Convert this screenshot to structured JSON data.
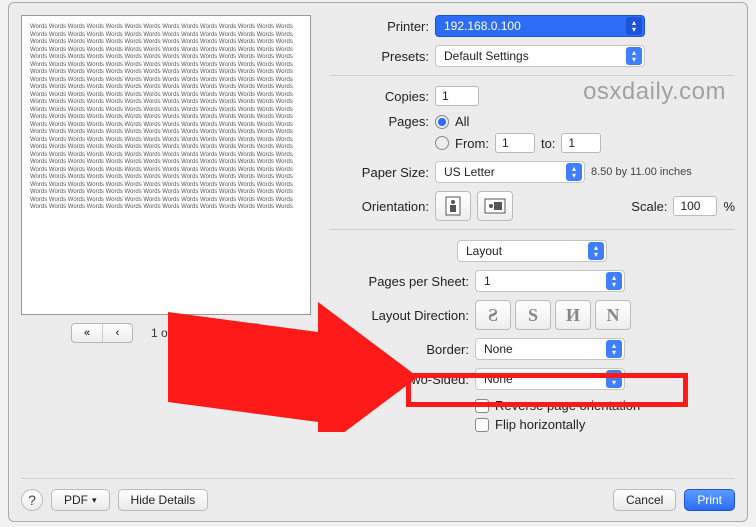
{
  "watermark": "osxdaily.com",
  "preview": {
    "page_indicator": "1 of 3",
    "filler": "Words Words Words Words Words Words Words Words Words Words Words Words Words Words Words Words Words Words Words Words Words Words Words Words Words Words Words Words Words Words Words Words Words Words Words Words Words Words Words Words Words Words Words Words Words Words Words Words Words Words Words Words Words Words Words Words Words Words Words Words Words Words Words Words Words Words Words Words Words Words Words Words Words Words Words Words Words Words Words Words Words Words Words Words Words Words Words Words Words Words Words Words Words Words Words Words Words Words Words Words Words Words Words Words Words Words Words Words Words Words Words Words Words Words Words Words Words Words Words Words Words Words Words Words Words Words Words Words Words Words Words Words Words Words Words Words Words Words Words Words Words Words Words Words Words Words Words Words Words Words Words Words Words Words Words Words Words Words Words Words Words Words Words Words Words Words Words Words Words Words Words Words Words Words Words Words Words Words Words Words Words Words Words Words Words Words Words Words Words Words Words Words Words Words Words Words Words Words Words Words Words Words Words Words Words Words Words Words Words Words Words Words Words Words Words Words Words Words Words Words Words Words Words Words Words Words Words Words Words Words Words Words Words Words Words Words Words Words Words Words Words Words Words Words Words Words Words Words Words Words Words Words Words Words Words Words Words Words Words Words Words Words Words Words Words Words Words Words Words Words Words Words Words Words Words Words Words Words Words Words Words Words Words Words Words Words Words Words Words Words Words Words Words Words Words Words Words Words Words Words Words Words Words Words Words Words Words Words Words Words Words Words Words Words Words Words Words Words Words Words Words Words Words Words Words Words Words Words Words Words Words Words Words Words Words Words Words Words Words Words Words Words Words Words Words Words Words Words Words Words"
  },
  "labels": {
    "printer": "Printer:",
    "presets": "Presets:",
    "copies": "Copies:",
    "pages": "Pages:",
    "all": "All",
    "from": "From:",
    "to": "to:",
    "paper_size": "Paper Size:",
    "paper_dims": "8.50 by 11.00 inches",
    "orientation": "Orientation:",
    "scale": "Scale:",
    "percent": "%",
    "section": "Layout",
    "pages_per_sheet": "Pages per Sheet:",
    "layout_direction": "Layout Direction:",
    "border": "Border:",
    "two_sided": "Two-Sided:",
    "reverse": "Reverse page orientation",
    "flip": "Flip horizontally",
    "pdf": "PDF",
    "hide_details": "Hide Details",
    "cancel": "Cancel",
    "print": "Print"
  },
  "values": {
    "printer": "192.168.0.100",
    "presets": "Default Settings",
    "copies": "1",
    "from": "1",
    "to": "1",
    "paper_size": "US Letter",
    "scale": "100",
    "pages_per_sheet": "1",
    "border": "None",
    "two_sided": "None"
  },
  "direction_glyphs": [
    "Ƨ",
    "S",
    "И",
    "N"
  ]
}
